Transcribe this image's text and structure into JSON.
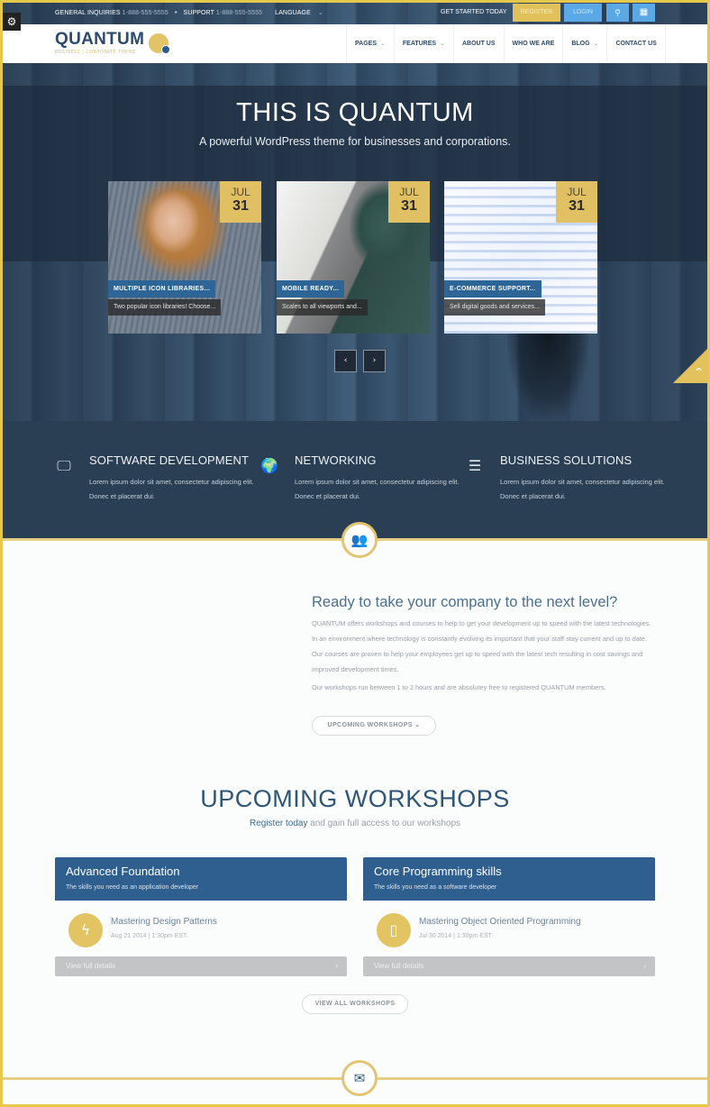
{
  "topbar": {
    "general_label": "GENERAL INQUIRIES",
    "general_phone": "1-888-555-5555",
    "separator": "•",
    "support_label": "SUPPORT",
    "support_phone": "1-888-555-5555",
    "language_label": "LANGUAGE",
    "language_chevron": "⌄",
    "cta_text": "GET STARTED TODAY",
    "register_label": "REGISTER",
    "login_label": "LOGIN",
    "search_icon": "⚲",
    "grid_icon": "▦",
    "settings_icon": "⚙"
  },
  "logo": {
    "wordmark": "QUANTUM",
    "tagline": "BUSINESS | CORPORATE THEME"
  },
  "nav": {
    "items": [
      {
        "label": "PAGES",
        "has_dropdown": true,
        "chevron": "⌄"
      },
      {
        "label": "FEATURES",
        "has_dropdown": true,
        "chevron": "⌄"
      },
      {
        "label": "ABOUT US",
        "has_dropdown": false
      },
      {
        "label": "WHO WE ARE",
        "has_dropdown": false
      },
      {
        "label": "BLOG",
        "has_dropdown": true,
        "chevron": "⌄"
      },
      {
        "label": "CONTACT US",
        "has_dropdown": false
      }
    ]
  },
  "hero": {
    "title": "THIS IS QUANTUM",
    "subtitle": "A powerful WordPress theme for businesses and corporations.",
    "cards": [
      {
        "month": "JUL",
        "day": "31",
        "title": "MULTIPLE ICON LIBRARIES...",
        "excerpt": "Two popular icon libraries! Choose..."
      },
      {
        "month": "JUL",
        "day": "31",
        "title": "MOBILE READY...",
        "excerpt": "Scales to all viewports and..."
      },
      {
        "month": "JUL",
        "day": "31",
        "title": "E-COMMERCE SUPPORT...",
        "excerpt": "Sell digital goods and services..."
      }
    ],
    "prev_icon": "‹",
    "next_icon": "›",
    "scroll_top_icon": "^"
  },
  "services": [
    {
      "icon": "🖵",
      "title": "SOFTWARE DEVELOPMENT",
      "desc": "Lorem ipsum dolor sit amet, consectetur adipiscing elit. Donec et placerat dui."
    },
    {
      "icon": "🌍",
      "title": "NETWORKING",
      "desc": "Lorem ipsum dolor sit amet, consectetur adipiscing elit. Donec et placerat dui."
    },
    {
      "icon": "☰",
      "title": "BUSINESS SOLUTIONS",
      "desc": "Lorem ipsum dolor sit amet, consectetur adipiscing elit. Donec et placerat dui."
    }
  ],
  "section_badges": {
    "team_icon": "👥",
    "mail_icon": "✉"
  },
  "about": {
    "heading": "Ready to take your company to the next level?",
    "paragraph1": "QUANTUM offers workshops and courses to help to get your development up to speed with the latest technologies. In an environment where technology is constantly evolving its important that your staff stay current and up to date. Our courses are proven to help your employees get up to speed with the latest tech resulting in cost savings and improved development times.",
    "paragraph2": "Our workshops run between 1 to 2 hours and are absolutey free to registered QUANTUM members.",
    "button_label": "UPCOMING WORKSHOPS  ⌄"
  },
  "workshops": {
    "title": "UPCOMING WORKSHOPS",
    "subtitle_strong": "Register today",
    "subtitle_rest": " and gain full access to our workshops",
    "cards": [
      {
        "name": "Advanced Foundation",
        "tagline": "The skills you need as an application developer",
        "icon": "ϟ",
        "course": "Mastering Design Patterns",
        "date": "Aug 21 2014  |  1:30pm EST.",
        "details_label": "View full details",
        "chevron": "›"
      },
      {
        "name": "Core Programming skills",
        "tagline": "The skills you need as a software developer",
        "icon": "▯",
        "course": "Mastering Object Oriented Programming",
        "date": "Jul 30 2014  |  1:30pm EST.",
        "details_label": "View full details",
        "chevron": "›"
      }
    ],
    "view_all_label": "VIEW ALL WORKSHOPS"
  },
  "colors": {
    "accent_gold": "#e0c062",
    "brand_navy": "#2a3f54",
    "brand_blue": "#2e5f8e",
    "login_blue": "#5aa9e6"
  }
}
